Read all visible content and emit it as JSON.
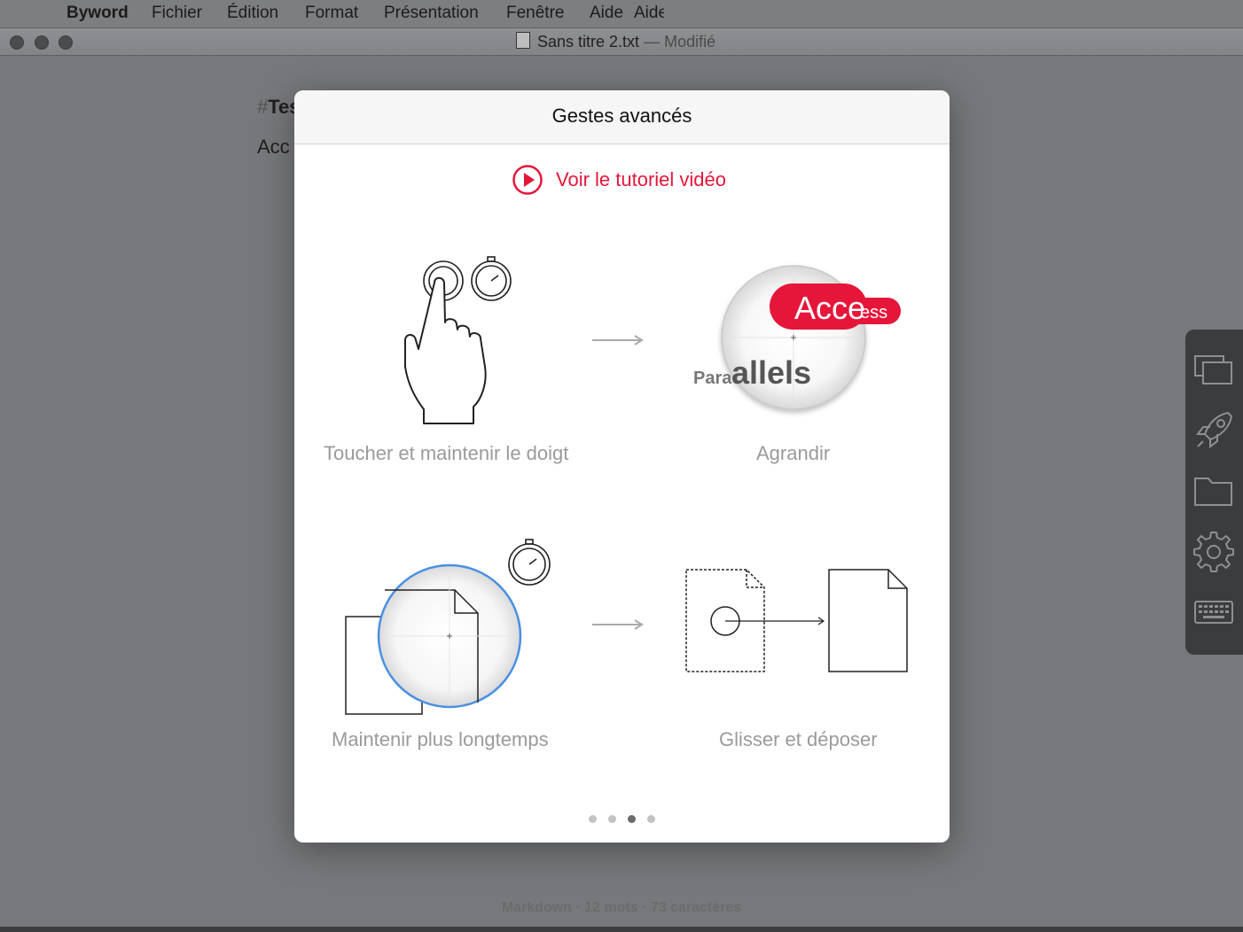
{
  "menubar": {
    "app": "Byword",
    "items": [
      "Fichier",
      "Édition",
      "Format",
      "Présentation",
      "Fenêtre",
      "Aide"
    ],
    "overlap_fragment": "Aide"
  },
  "window": {
    "title": "Sans titre 2.txt",
    "separator": "—",
    "state": "Modifié"
  },
  "editor": {
    "line1_hash": "#",
    "line1_text": "Tes",
    "line2_text": "Acc"
  },
  "statusbar": {
    "text": "Markdown · 12 mots · 73 caractères"
  },
  "sidebar": {
    "icons": [
      "windows-icon",
      "rocket-icon",
      "folder-icon",
      "gear-icon",
      "keyboard-icon"
    ]
  },
  "modal": {
    "title": "Gestes avancés",
    "video_link": "Voir le tutoriel vidéo",
    "captions": {
      "touch_hold": "Toucher et maintenir le doigt",
      "magnify": "Agrandir",
      "hold_longer": "Maintenir plus longtemps",
      "drag_drop": "Glisser et déposer"
    },
    "magnify_text": {
      "highlight_big": "Acce",
      "highlight_small": "ess",
      "para_small": "Para",
      "para_big": "allels"
    },
    "pagination": {
      "total": 4,
      "current": 3
    }
  },
  "colors": {
    "accent": "#e5163a",
    "magnifier_ring": "#4a90e2"
  }
}
